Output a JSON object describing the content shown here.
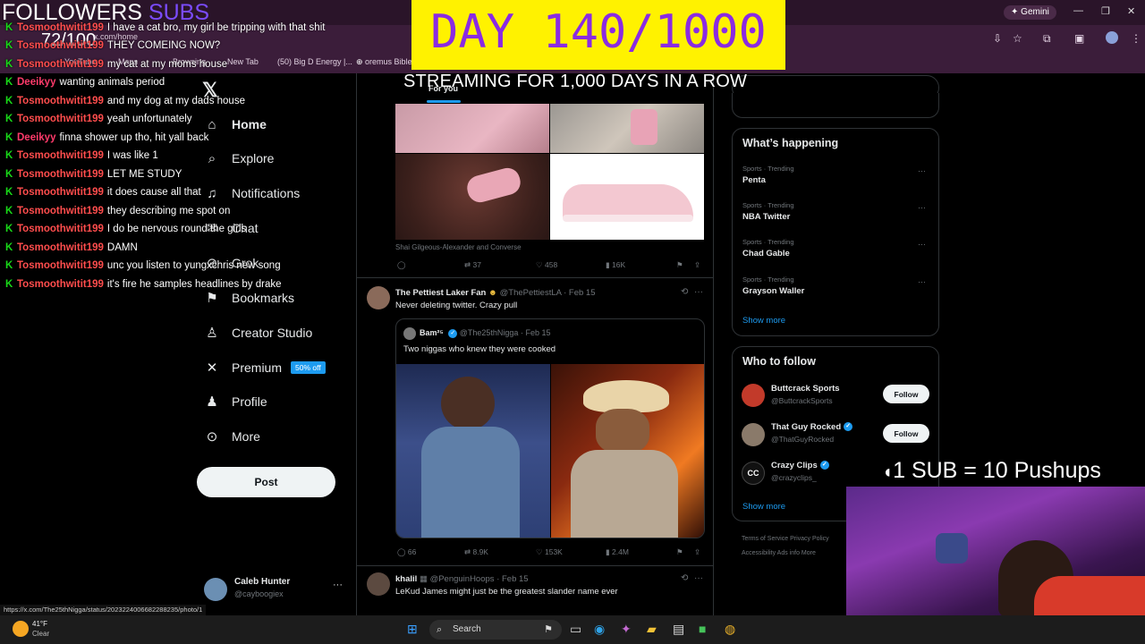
{
  "browser": {
    "gemini_label": "Gemini",
    "url_partial": "x.com/home",
    "bookmarks": [
      "YouTube",
      "Maps",
      "Browsing",
      "New Tab",
      "(50) Big D Energy |...",
      "oremus Bible"
    ]
  },
  "overlay": {
    "followers_label": "FOLLOWERS",
    "subs_label": "SUBS",
    "goal": "72/100",
    "day_banner": "DAY 140/1000",
    "streaming": "STREAMING FOR 1,000 DAYS IN A ROW",
    "sub_rule": "1 SUB = 10 Pushups"
  },
  "chat": [
    {
      "user": "Tosmoothwitit199",
      "msg": "I have a cat bro, my girl be tripping with that shit"
    },
    {
      "user": "Tosmoothwitit199",
      "msg": "THEY COMEING NOW?"
    },
    {
      "user": "Tosmoothwitit199",
      "msg": "my cat at my moms house"
    },
    {
      "user": "Deeikyy",
      "msg": "wanting animals period"
    },
    {
      "user": "Tosmoothwitit199",
      "msg": "and my dog at my dads house"
    },
    {
      "user": "Tosmoothwitit199",
      "msg": "yeah unfortunately"
    },
    {
      "user": "Deeikyy",
      "msg": "finna shower up tho, hit yall back"
    },
    {
      "user": "Tosmoothwitit199",
      "msg": "I was like 1"
    },
    {
      "user": "Tosmoothwitit199",
      "msg": "LET ME STUDY"
    },
    {
      "user": "Tosmoothwitit199",
      "msg": "it does cause all that"
    },
    {
      "user": "Tosmoothwitit199",
      "msg": "they describing me spot on"
    },
    {
      "user": "Tosmoothwitit199",
      "msg": "I do be nervous round the girls"
    },
    {
      "user": "Tosmoothwitit199",
      "msg": "DAMN"
    },
    {
      "user": "Tosmoothwitit199",
      "msg": "unc you listen to yungxchris new song"
    },
    {
      "user": "Tosmoothwitit199",
      "msg": "it's fire he samples headlines by drake"
    }
  ],
  "sidebar": {
    "items": [
      {
        "label": "Home"
      },
      {
        "label": "Explore"
      },
      {
        "label": "Notifications"
      },
      {
        "label": "Chat"
      },
      {
        "label": "Grok"
      },
      {
        "label": "Bookmarks"
      },
      {
        "label": "Creator Studio"
      },
      {
        "label": "Premium",
        "badge": "50% off"
      },
      {
        "label": "Profile"
      },
      {
        "label": "More"
      }
    ],
    "post_label": "Post",
    "account": {
      "name": "Caleb Hunter",
      "handle": "@cayboogiex"
    }
  },
  "feed": {
    "tab_active": "For you",
    "tweet1": {
      "caption": "Shai Gilgeous-Alexander and Converse",
      "replies": "",
      "reposts": "37",
      "likes": "458",
      "views": "16K"
    },
    "tweet2": {
      "name": "The Pettiest Laker Fan",
      "handle": "@ThePettiestLA",
      "date": "· Feb 15",
      "text": "Never deleting twitter. Crazy pull",
      "quote_name": "Bam²⁵",
      "quote_handle": "@The25thNigga",
      "quote_date": "· Feb 15",
      "quote_text": "Two niggas who knew they were cooked",
      "replies": "66",
      "reposts": "8.9K",
      "likes": "153K",
      "views": "2.4M"
    },
    "tweet3": {
      "name": "khalil",
      "handle": "@PenguinHoops",
      "date": "· Feb 15",
      "text": "LeKud James might just be the greatest slander name ever"
    }
  },
  "trends": {
    "title": "What’s happening",
    "items": [
      {
        "category": "Sports · Trending",
        "name": "Penta"
      },
      {
        "category": "Sports · Trending",
        "name": "NBA Twitter"
      },
      {
        "category": "Sports · Trending",
        "name": "Chad Gable"
      },
      {
        "category": "Sports · Trending",
        "name": "Grayson Waller"
      }
    ],
    "show_more": "Show more"
  },
  "who_to_follow": {
    "title": "Who to follow",
    "items": [
      {
        "name": "Buttcrack Sports",
        "handle": "@ButtcrackSports",
        "button": "Follow"
      },
      {
        "name": "That Guy Rocked",
        "handle": "@ThatGuyRocked",
        "button": "Follow"
      },
      {
        "name": "Crazy Clips",
        "handle": "@crazyclips_",
        "button": ""
      }
    ],
    "show_more": "Show more"
  },
  "footer": {
    "links_row1": "Terms of Service   Privacy Policy",
    "links_row2": "Accessibility   Ads info   More"
  },
  "status_url": "https://x.com/The25thNigga/status/2023224006682288235/photo/1",
  "taskbar": {
    "weather_temp": "41°F",
    "weather_desc": "Clear",
    "search_label": "Search"
  },
  "colors": {
    "accent": "#1d9bf0",
    "banner": "#fff200",
    "banner_text": "#8a2be2",
    "chat_k": "#18d818"
  }
}
